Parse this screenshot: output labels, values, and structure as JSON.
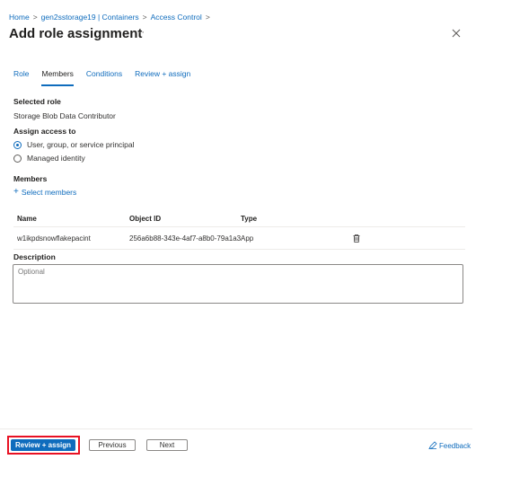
{
  "breadcrumb": {
    "items": [
      "Home",
      "gen2sstorage19 | Containers",
      "Access Control"
    ],
    "separator": ">"
  },
  "page": {
    "title": "Add role assignment",
    "more_label": "···"
  },
  "tabs": [
    {
      "label": "Role"
    },
    {
      "label": "Members"
    },
    {
      "label": "Conditions"
    },
    {
      "label": "Review + assign"
    }
  ],
  "selected_role": {
    "label": "Selected role",
    "value": "Storage Blob Data Contributor"
  },
  "assign_access": {
    "label": "Assign access to",
    "options": [
      {
        "label": "User, group, or service principal",
        "checked": true
      },
      {
        "label": "Managed identity",
        "checked": false
      }
    ]
  },
  "members": {
    "label": "Members",
    "select_link": "Select members",
    "columns": [
      "Name",
      "Object ID",
      "Type"
    ],
    "rows": [
      {
        "name": "w1ikpdsnowflakepacint",
        "object_id": "256a6b88-343e-4af7-a8b0-79a1a3…",
        "type": "App"
      }
    ]
  },
  "description": {
    "label": "Description",
    "placeholder": "Optional"
  },
  "footer": {
    "review_assign": "Review + assign",
    "previous": "Previous",
    "next": "Next",
    "feedback": "Feedback"
  },
  "colors": {
    "accent": "#0f6cbd",
    "highlight": "#e81123"
  }
}
